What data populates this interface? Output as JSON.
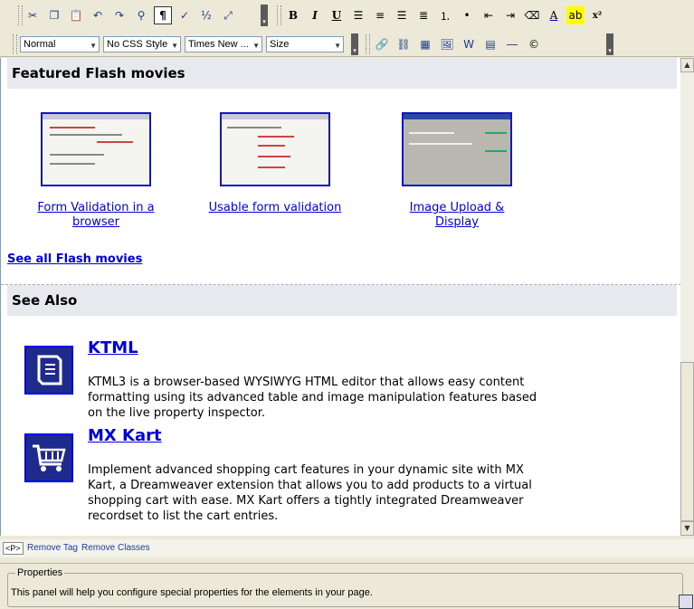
{
  "toolbar1": {
    "buttons": [
      "cut-icon",
      "copy-icon",
      "paste-icon",
      "undo-icon",
      "redo-icon",
      "find-icon",
      "paragraph-marks-icon",
      "spellcheck-icon",
      "fraction-icon",
      "resize-icon"
    ],
    "format_buttons": {
      "bold": "B",
      "italic": "I",
      "underline": "U",
      "superscript": "x²"
    }
  },
  "toolbar2": {
    "paragraph_select": "Normal",
    "css_select": "No CSS Style",
    "font_select": "Times New ...",
    "size_select": "Size",
    "symbol": "©"
  },
  "editor": {
    "featured_heading": "Featured Flash movies",
    "movies": [
      {
        "title": "Form Validation in a browser"
      },
      {
        "title": "Usable form validation"
      },
      {
        "title": "Image Upload & Display"
      }
    ],
    "see_all_link": "See all Flash movies",
    "see_also_heading": "See Also",
    "products": [
      {
        "title": "KTML",
        "description": "KTML3 is a browser-based WYSIWYG HTML editor that allows easy content formatting using its advanced table and image manipulation features based on the live property inspector."
      },
      {
        "title": "MX Kart",
        "description": "Implement advanced shopping cart features in your dynamic site with MX Kart, a Dreamweaver extension that allows you to add products to a virtual shopping cart with ease. MX Kart offers a tightly integrated Dreamweaver recordset to list the cart entries."
      }
    ]
  },
  "tagbar": {
    "current_tag": "<P>",
    "remove_tag": "Remove Tag",
    "remove_classes": "Remove Classes"
  },
  "properties": {
    "legend": "Properties",
    "message": "This panel will help you configure special properties for the elements in your page."
  },
  "colors": {
    "link": "#0000dd",
    "section_bg": "#e8e9ef",
    "product_icon_bg": "#1e2a8c",
    "chrome": "#ece9d8"
  }
}
